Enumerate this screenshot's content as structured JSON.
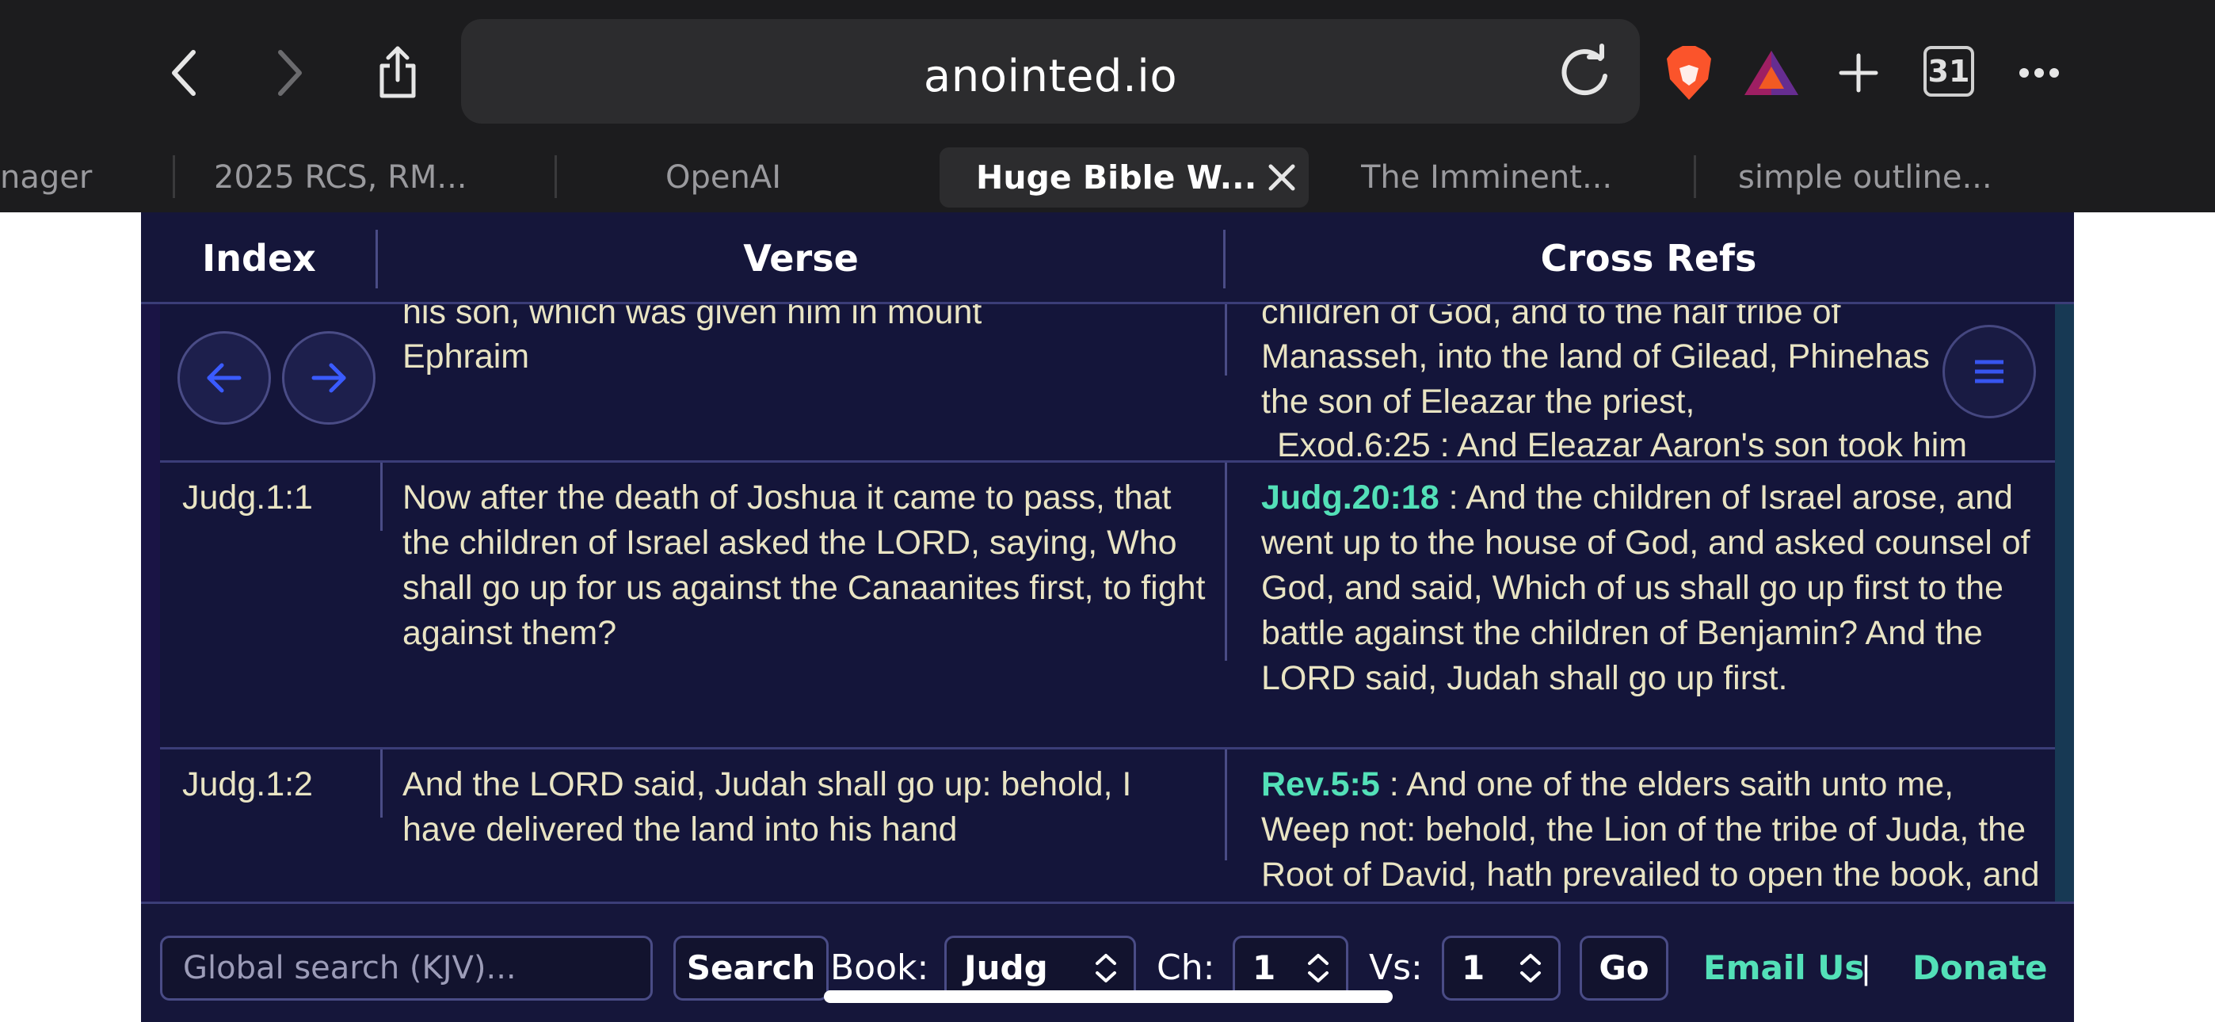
{
  "browser": {
    "url": "anointed.io",
    "tab_count": "31",
    "tabs": [
      {
        "label": "nager"
      },
      {
        "label": "2025 RCS, RM..."
      },
      {
        "label": "OpenAI"
      },
      {
        "label": "Huge Bible W..."
      },
      {
        "label": "The Imminent..."
      },
      {
        "label": "simple outline..."
      }
    ],
    "icons": {
      "back": "chevron-left-icon",
      "forward": "chevron-right-icon",
      "share": "share-icon",
      "reload": "reload-icon",
      "brave": "brave-lion-icon",
      "rewards": "brave-rewards-triangle-icon",
      "new_tab": "plus-icon",
      "more": "more-icon"
    }
  },
  "table": {
    "headers": {
      "index": "Index",
      "verse": "Verse",
      "refs": "Cross Refs"
    },
    "top_row": {
      "verse_partial": "his son, which was given him in mount",
      "verse_line": "Ephraim",
      "refs_partial_top": "children of God, and to the half tribe of",
      "refs_line1": "Manasseh, into the land of Gilead, Phinehas",
      "refs_line2": "the son of Eleazar the priest,",
      "refs_partial_bottom": "Exod.6:25 : And Eleazar Aaron's son took him"
    },
    "rows": [
      {
        "index": "Judg.1:1",
        "verse": "Now after the death of Joshua it came to pass, that the children of Israel asked the LORD, saying, Who shall go up for us against the Canaanites first, to fight against them?",
        "ref_key": "Judg.20:18",
        "ref_text": " : And the children of Israel arose, and went up to the house of God, and asked counsel of God, and said, Which of us shall go up first to the battle against the children of Benjamin? And the LORD said, Judah shall go up first."
      },
      {
        "index": "Judg.1:2",
        "verse": "And the LORD said, Judah shall go up: behold, I have delivered the land into his hand",
        "ref_key": "Rev.5:5",
        "ref_text": " : And one of the elders saith unto me, Weep not: behold, the Lion of the tribe of Juda, the Root of David, hath prevailed to open the book, and to loose the seven seals thereof."
      }
    ]
  },
  "footer": {
    "search_placeholder": "Global search (KJV)...",
    "search_button": "Search",
    "book_label": "Book:",
    "book_value": "Judg",
    "chapter_label": "Ch:",
    "chapter_value": "1",
    "verse_label": "Vs:",
    "verse_value": "1",
    "go_button": "Go",
    "email_link": "Email Us",
    "separator": "|",
    "donate_link": "Donate"
  },
  "colors": {
    "page_bg": "#12132e",
    "accent_green": "#53e0b8",
    "text_cream": "#e9e4c3",
    "nav_blue": "#3a5bff"
  }
}
